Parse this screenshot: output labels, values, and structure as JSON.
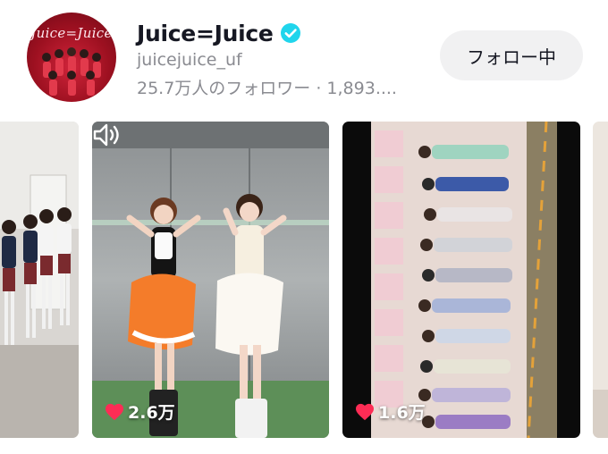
{
  "profile": {
    "avatar_logo_text": "Juice=Juice",
    "name": "Juice=Juice",
    "verified_icon": "verified-badge-icon",
    "handle": "juicejuice_uf",
    "stats": "25.7万人のフォロワー · 1,893....",
    "follow_button_label": "フォロー中"
  },
  "videos": [
    {
      "id": "video-1",
      "likes": ""
    },
    {
      "id": "video-2",
      "likes": "2.6万",
      "like_icon": "heart-icon",
      "sound_icon": "speaker-icon"
    },
    {
      "id": "video-3",
      "likes": "1.6万",
      "like_icon": "heart-icon"
    },
    {
      "id": "video-4",
      "likes": ""
    }
  ],
  "colors": {
    "verified": "#20d5ec",
    "like_heart": "#fe2c55",
    "follow_button_bg": "#f1f1f2",
    "secondary_text": "#8a8b91"
  }
}
